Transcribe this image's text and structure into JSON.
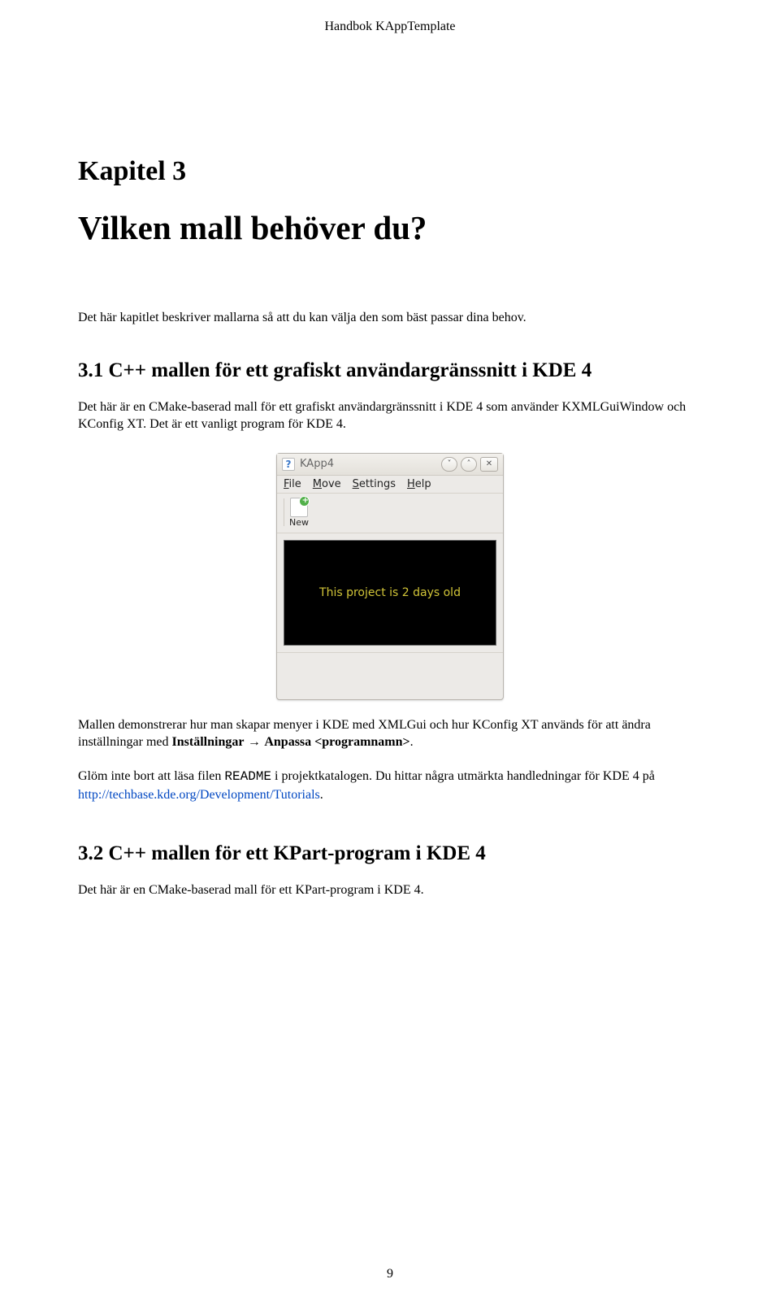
{
  "page": {
    "running_header": "Handbok KAppTemplate",
    "number": "9"
  },
  "chapter": {
    "label": "Kapitel 3",
    "title": "Vilken mall behöver du?",
    "intro": "Det här kapitlet beskriver mallarna så att du kan välja den som bäst passar dina behov."
  },
  "section31": {
    "heading": "3.1   C++ mallen för ett grafiskt användargränssnitt i KDE 4",
    "p1": "Det här är en CMake-baserad mall för ett grafiskt användargränssnitt i KDE 4 som använder KXMLGuiWindow och KConfig XT. Det är ett vanligt program för KDE 4.",
    "p2a": "Mallen demonstrerar hur man skapar menyer i KDE med XMLGui och hur KConfig XT används för att ändra inställningar med ",
    "p2_bold1": "Inställningar",
    "p2_arrow": " → ",
    "p2_bold2": "Anpassa <programnamn>",
    "p2b": ".",
    "p3a": "Glöm inte bort att läsa filen ",
    "p3_mono": "README",
    "p3b": " i projektkatalogen. Du hittar några utmärkta handledningar för KDE 4 på ",
    "p3_link": "http://techbase.kde.org/Development/Tutorials",
    "p3c": "."
  },
  "section32": {
    "heading": "3.2   C++ mallen för ett KPart-program i KDE 4",
    "p1": "Det här är en CMake-baserad mall för ett KPart-program i KDE 4."
  },
  "screenshot": {
    "title": "KApp4",
    "menus": {
      "file": "File",
      "move": "Move",
      "settings": "Settings",
      "help": "Help"
    },
    "toolbar": {
      "new": "New"
    },
    "canvas_text": "This project is 2 days old"
  }
}
